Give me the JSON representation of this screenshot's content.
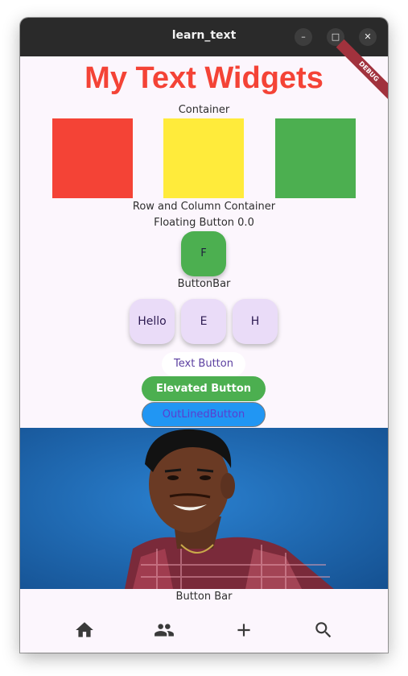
{
  "window": {
    "title": "learn_text",
    "controls": {
      "minimize": "–",
      "maximize": "□",
      "close": "✕"
    }
  },
  "debug_banner": "DEBUG",
  "heading": "My Text Widgets",
  "labels": {
    "container": "Container",
    "row_column": "Row and Column Container",
    "floating": "Floating Button 0.0",
    "button_bar_top": "ButtonBar",
    "button_bar_bottom": "Button Bar"
  },
  "colors": {
    "red": "#f44336",
    "yellow": "#ffeb3b",
    "green": "#4caf50",
    "blue": "#2196f3",
    "chip": "#eadcf8",
    "background": "#fcf6fd"
  },
  "fab": {
    "label": "F"
  },
  "button_bar": [
    {
      "label": "Hello"
    },
    {
      "label": "E"
    },
    {
      "label": "H"
    }
  ],
  "buttons": {
    "text_button": "Text Button",
    "elevated_button": "Elevated Button",
    "outlined_button": "OutLinedButton"
  },
  "bottom_nav": [
    {
      "icon": "home-icon"
    },
    {
      "icon": "people-icon"
    },
    {
      "icon": "add-icon"
    },
    {
      "icon": "search-icon"
    }
  ]
}
